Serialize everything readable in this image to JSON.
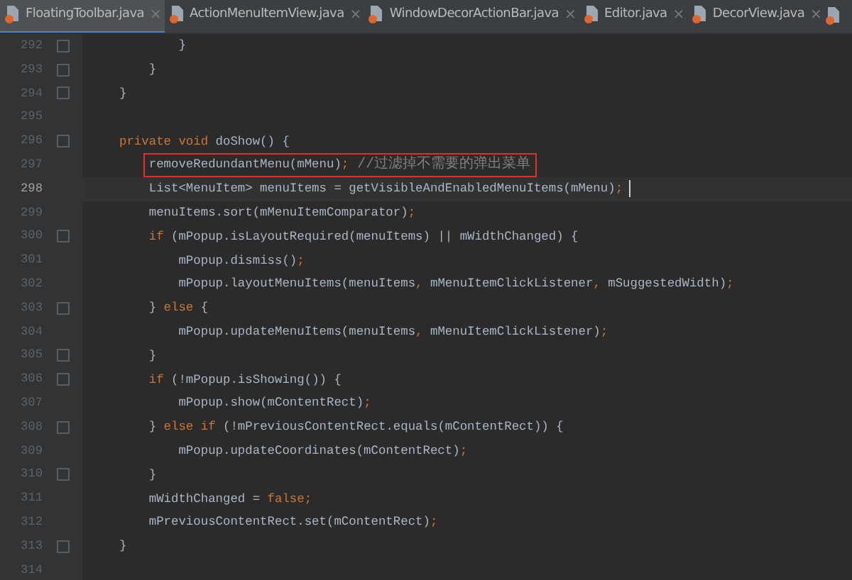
{
  "tabs": [
    {
      "label": "FloatingToolbar.java",
      "close": "×",
      "selected": true
    },
    {
      "label": "ActionMenuItemView.java",
      "close": "×",
      "selected": false
    },
    {
      "label": "WindowDecorActionBar.java",
      "close": "×",
      "selected": false
    },
    {
      "label": "Editor.java",
      "close": "×",
      "selected": false
    },
    {
      "label": "DecorView.java",
      "close": "×",
      "selected": false
    }
  ],
  "editor": {
    "lines": [
      {
        "number": "292",
        "fold": true,
        "current": false,
        "boxed": false,
        "caret": false,
        "tokens": [
          {
            "kind": "plain",
            "text": "        }"
          }
        ]
      },
      {
        "number": "293",
        "fold": true,
        "current": false,
        "boxed": false,
        "caret": false,
        "tokens": [
          {
            "kind": "plain",
            "text": "    }"
          }
        ]
      },
      {
        "number": "294",
        "fold": true,
        "current": false,
        "boxed": false,
        "caret": false,
        "tokens": [
          {
            "kind": "plain",
            "text": "}"
          }
        ]
      },
      {
        "number": "295",
        "fold": false,
        "current": false
      },
      {
        "number": "296",
        "fold": true,
        "current": false,
        "boxed": false,
        "caret": false,
        "tokens": [
          {
            "kind": "keyword",
            "text": "private void"
          },
          {
            "kind": "plain",
            "text": " doShow() {"
          }
        ]
      },
      {
        "number": "297",
        "fold": false,
        "current": false,
        "boxed": true,
        "caret": false,
        "tokens": [
          {
            "kind": "plain",
            "text": "    removeRedundantMenu(mMenu)"
          },
          {
            "kind": "keyword",
            "text": ";"
          },
          {
            "kind": "comment",
            "text": " //过滤掉不需要的弹出菜单"
          }
        ]
      },
      {
        "number": "298",
        "fold": false,
        "current": true,
        "boxed": false,
        "caret": true,
        "tokens": [
          {
            "kind": "plain",
            "text": "    List<MenuItem> menuItems = getVisibleAndEnabledMenuItems(mMenu)"
          },
          {
            "kind": "keyword",
            "text": ";"
          }
        ]
      },
      {
        "number": "299",
        "fold": false,
        "current": false,
        "boxed": false,
        "caret": false,
        "tokens": [
          {
            "kind": "plain",
            "text": "    menuItems.sort(mMenuItemComparator)"
          },
          {
            "kind": "keyword",
            "text": ";"
          }
        ]
      },
      {
        "number": "300",
        "fold": true,
        "current": false,
        "boxed": false,
        "caret": false,
        "tokens": [
          {
            "kind": "keyword",
            "text": "    if"
          },
          {
            "kind": "plain",
            "text": " (mPopup.isLayoutRequired(menuItems) || mWidthChanged) {"
          }
        ]
      },
      {
        "number": "301",
        "fold": false,
        "current": false,
        "boxed": false,
        "caret": false,
        "tokens": [
          {
            "kind": "plain",
            "text": "        mPopup.dismiss()"
          },
          {
            "kind": "keyword",
            "text": ";"
          }
        ]
      },
      {
        "number": "302",
        "fold": false,
        "current": false,
        "boxed": false,
        "caret": false,
        "tokens": [
          {
            "kind": "plain",
            "text": "        mPopup.layoutMenuItems(menuItems"
          },
          {
            "kind": "keyword",
            "text": ","
          },
          {
            "kind": "plain",
            "text": " mMenuItemClickListener"
          },
          {
            "kind": "keyword",
            "text": ","
          },
          {
            "kind": "plain",
            "text": " mSuggestedWidth)"
          },
          {
            "kind": "keyword",
            "text": ";"
          }
        ]
      },
      {
        "number": "303",
        "fold": true,
        "current": false,
        "boxed": false,
        "caret": false,
        "tokens": [
          {
            "kind": "plain",
            "text": "    } "
          },
          {
            "kind": "keyword",
            "text": "else"
          },
          {
            "kind": "plain",
            "text": " {"
          }
        ]
      },
      {
        "number": "304",
        "fold": false,
        "current": false,
        "boxed": false,
        "caret": false,
        "tokens": [
          {
            "kind": "plain",
            "text": "        mPopup.updateMenuItems(menuItems"
          },
          {
            "kind": "keyword",
            "text": ","
          },
          {
            "kind": "plain",
            "text": " mMenuItemClickListener)"
          },
          {
            "kind": "keyword",
            "text": ";"
          }
        ]
      },
      {
        "number": "305",
        "fold": true,
        "current": false,
        "boxed": false,
        "caret": false,
        "tokens": [
          {
            "kind": "plain",
            "text": "    }"
          }
        ]
      },
      {
        "number": "306",
        "fold": true,
        "current": false,
        "boxed": false,
        "caret": false,
        "tokens": [
          {
            "kind": "keyword",
            "text": "    if"
          },
          {
            "kind": "plain",
            "text": " (!mPopup.isShowing()) {"
          }
        ]
      },
      {
        "number": "307",
        "fold": false,
        "current": false,
        "boxed": false,
        "caret": false,
        "tokens": [
          {
            "kind": "plain",
            "text": "        mPopup.show(mContentRect)"
          },
          {
            "kind": "keyword",
            "text": ";"
          }
        ]
      },
      {
        "number": "308",
        "fold": true,
        "current": false,
        "boxed": false,
        "caret": false,
        "tokens": [
          {
            "kind": "plain",
            "text": "    } "
          },
          {
            "kind": "keyword",
            "text": "else if"
          },
          {
            "kind": "plain",
            "text": " (!mPreviousContentRect.equals(mContentRect)) {"
          }
        ]
      },
      {
        "number": "309",
        "fold": false,
        "current": false,
        "boxed": false,
        "caret": false,
        "tokens": [
          {
            "kind": "plain",
            "text": "        mPopup.updateCoordinates(mContentRect)"
          },
          {
            "kind": "keyword",
            "text": ";"
          }
        ]
      },
      {
        "number": "310",
        "fold": true,
        "current": false,
        "boxed": false,
        "caret": false,
        "tokens": [
          {
            "kind": "plain",
            "text": "    }"
          }
        ]
      },
      {
        "number": "311",
        "fold": false,
        "current": false,
        "boxed": false,
        "caret": false,
        "tokens": [
          {
            "kind": "plain",
            "text": "    mWidthChanged = "
          },
          {
            "kind": "keyword",
            "text": "false;"
          }
        ]
      },
      {
        "number": "312",
        "fold": false,
        "current": false,
        "boxed": false,
        "caret": false,
        "tokens": [
          {
            "kind": "plain",
            "text": "    mPreviousContentRect.set(mContentRect)"
          },
          {
            "kind": "keyword",
            "text": ";"
          }
        ]
      },
      {
        "number": "313",
        "fold": true,
        "current": false,
        "boxed": false,
        "caret": false,
        "tokens": [
          {
            "kind": "plain",
            "text": "}"
          }
        ]
      },
      {
        "number": "314",
        "fold": false,
        "current": false
      }
    ]
  }
}
